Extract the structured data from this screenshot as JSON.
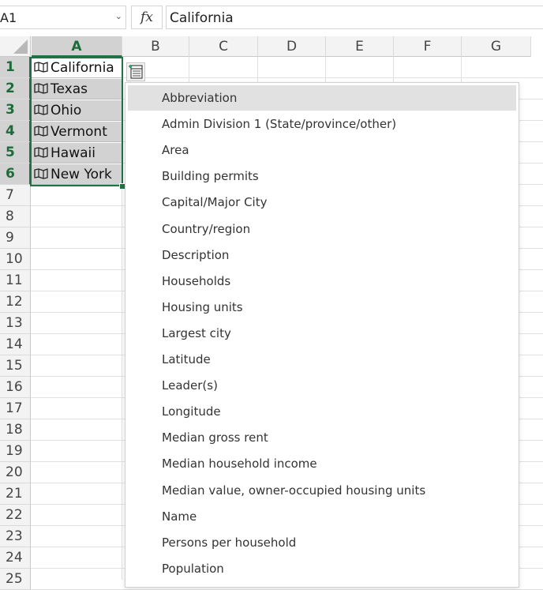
{
  "formula_bar": {
    "name_box": "A1",
    "fx_label": "fx",
    "formula": "California"
  },
  "columns": [
    "A",
    "B",
    "C",
    "D",
    "E",
    "F",
    "G"
  ],
  "selected_column": "A",
  "rows": [
    "1",
    "2",
    "3",
    "4",
    "5",
    "6",
    "7",
    "8",
    "9",
    "10",
    "11",
    "12",
    "13",
    "14",
    "15",
    "16",
    "17",
    "18",
    "19",
    "20",
    "21",
    "22",
    "23",
    "24",
    "25"
  ],
  "selected_rows": [
    "1",
    "2",
    "3",
    "4",
    "5",
    "6"
  ],
  "cells": [
    "California",
    "Texas",
    "Ohio",
    "Vermont",
    "Hawaii",
    "New York"
  ],
  "cell_icon": "geography-map-icon",
  "insert_data_icon": "insert-data-icon",
  "accent_color": "#217346",
  "dropdown": {
    "highlighted_index": 0,
    "items": [
      "Abbreviation",
      "Admin Division 1 (State/province/other)",
      "Area",
      "Building permits",
      "Capital/Major City",
      "Country/region",
      "Description",
      "Households",
      "Housing units",
      "Largest city",
      "Latitude",
      "Leader(s)",
      "Longitude",
      "Median gross rent",
      "Median household income",
      "Median value, owner-occupied housing units",
      "Name",
      "Persons per household",
      "Population"
    ]
  }
}
